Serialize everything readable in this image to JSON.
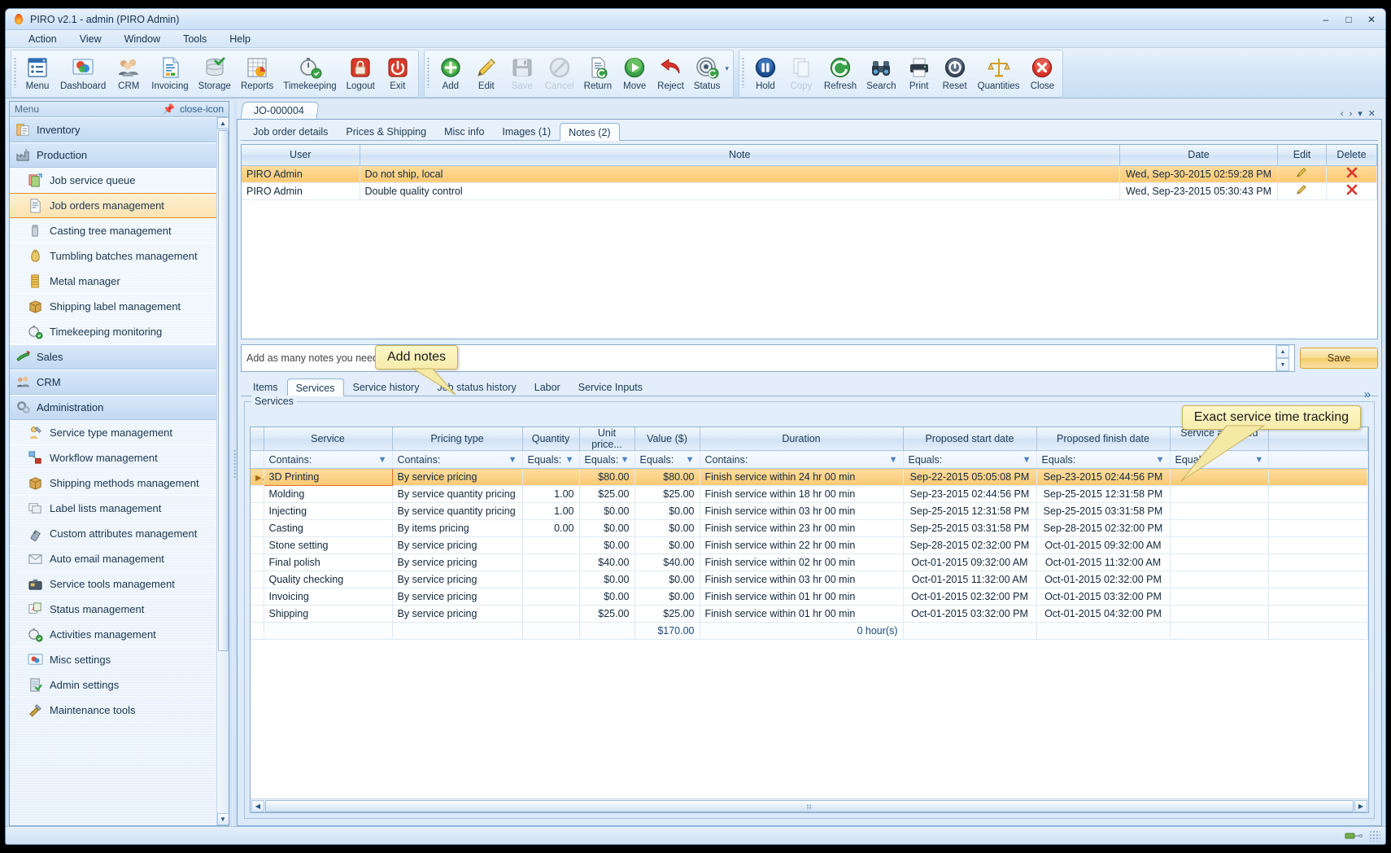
{
  "window": {
    "title": "PIRO v2.1  - admin (PIRO Admin)",
    "app_icon": "flame-icon",
    "minimize": "–",
    "maximize": "□",
    "close": "✕"
  },
  "menubar": [
    {
      "label": "Action"
    },
    {
      "label": "View"
    },
    {
      "label": "Window"
    },
    {
      "label": "Tools"
    },
    {
      "label": "Help"
    }
  ],
  "toolbar": {
    "group1": [
      {
        "label": "Menu",
        "icon": "menu-window-icon",
        "disabled": false
      },
      {
        "label": "Dashboard",
        "icon": "dashboard-icon",
        "disabled": false
      },
      {
        "label": "CRM",
        "icon": "people-icon",
        "disabled": false
      },
      {
        "label": "Invoicing",
        "icon": "document-invoice-icon",
        "disabled": false
      },
      {
        "label": "Storage",
        "icon": "database-icon",
        "disabled": false
      },
      {
        "label": "Reports",
        "icon": "report-chart-icon",
        "disabled": false
      },
      {
        "label": "Timekeeping",
        "icon": "stopwatch-icon",
        "disabled": false
      },
      {
        "label": "Logout",
        "icon": "lock-red-icon",
        "disabled": false
      },
      {
        "label": "Exit",
        "icon": "power-red-icon",
        "disabled": false
      }
    ],
    "group2": [
      {
        "label": "Add",
        "icon": "plus-green-icon",
        "disabled": false
      },
      {
        "label": "Edit",
        "icon": "pencil-icon",
        "disabled": false
      },
      {
        "label": "Save",
        "icon": "floppy-disk-icon",
        "disabled": true
      },
      {
        "label": "Cancel",
        "icon": "no-entry-icon",
        "disabled": true
      },
      {
        "label": "Return",
        "icon": "return-document-icon",
        "disabled": false
      },
      {
        "label": "Move",
        "icon": "play-green-icon",
        "disabled": false
      },
      {
        "label": "Reject",
        "icon": "red-arrow-icon",
        "disabled": false
      },
      {
        "label": "Status",
        "icon": "status-target-icon",
        "disabled": false,
        "has_dropdown": true
      }
    ],
    "group3": [
      {
        "label": "Hold",
        "icon": "pause-blue-icon",
        "disabled": false
      },
      {
        "label": "Copy",
        "icon": "copy-pages-icon",
        "disabled": true
      },
      {
        "label": "Refresh",
        "icon": "refresh-green-icon",
        "disabled": false
      },
      {
        "label": "Search",
        "icon": "binoculars-icon",
        "disabled": false
      },
      {
        "label": "Print",
        "icon": "printer-icon",
        "disabled": false
      },
      {
        "label": "Reset",
        "icon": "reset-power-icon",
        "disabled": false
      },
      {
        "label": "Quantities",
        "icon": "scales-icon",
        "disabled": false
      },
      {
        "label": "Close",
        "icon": "close-red-icon",
        "disabled": false
      }
    ]
  },
  "sidebar": {
    "caption": "Menu",
    "pin_icon": "pin-icon",
    "close_icon": "close-icon",
    "scroll_up": "▲",
    "scroll_down": "▼",
    "items": [
      {
        "label": "Inventory",
        "type": "group",
        "icon": "inventory-icon"
      },
      {
        "label": "Production",
        "type": "group",
        "icon": "factory-icon"
      },
      {
        "label": "Job service queue",
        "type": "item",
        "icon": "job-queue-icon"
      },
      {
        "label": "Job orders management",
        "type": "item",
        "icon": "job-orders-icon",
        "selected": true
      },
      {
        "label": "Casting tree management",
        "type": "item",
        "icon": "casting-tree-icon"
      },
      {
        "label": "Tumbling batches management",
        "type": "item",
        "icon": "tumbling-batch-icon"
      },
      {
        "label": "Metal manager",
        "type": "item",
        "icon": "metal-manager-icon"
      },
      {
        "label": "Shipping label management",
        "type": "item",
        "icon": "shipping-box-icon"
      },
      {
        "label": "Timekeeping monitoring",
        "type": "item",
        "icon": "stopwatch-icon"
      },
      {
        "label": "Sales",
        "type": "group",
        "icon": "sales-icon"
      },
      {
        "label": "CRM",
        "type": "group",
        "icon": "people-icon"
      },
      {
        "label": "Administration",
        "type": "group",
        "icon": "gears-icon"
      },
      {
        "label": "Service type management",
        "type": "item",
        "icon": "service-type-icon"
      },
      {
        "label": "Workflow management",
        "type": "item",
        "icon": "workflow-icon"
      },
      {
        "label": "Shipping methods management",
        "type": "item",
        "icon": "shipping-box-icon"
      },
      {
        "label": "Label lists management",
        "type": "item",
        "icon": "label-lists-icon"
      },
      {
        "label": "Custom attributes management",
        "type": "item",
        "icon": "custom-attributes-icon"
      },
      {
        "label": "Auto email management",
        "type": "item",
        "icon": "email-icon"
      },
      {
        "label": "Service tools management",
        "type": "item",
        "icon": "toolbox-icon"
      },
      {
        "label": "Status management",
        "type": "item",
        "icon": "status-cards-icon"
      },
      {
        "label": "Activities management",
        "type": "item",
        "icon": "stopwatch-icon"
      },
      {
        "label": "Misc settings",
        "type": "item",
        "icon": "misc-settings-icon"
      },
      {
        "label": "Admin settings",
        "type": "item",
        "icon": "admin-settings-icon"
      },
      {
        "label": "Maintenance tools",
        "type": "item",
        "icon": "maintenance-tools-icon"
      }
    ]
  },
  "document": {
    "tab_label": "JO-000004",
    "nav_prev": "‹",
    "nav_next": "›",
    "nav_list": "▾",
    "nav_close": "✕"
  },
  "top_tabs": [
    {
      "label": "Job order details",
      "active": false
    },
    {
      "label": "Prices & Shipping",
      "active": false
    },
    {
      "label": "Misc info",
      "active": false
    },
    {
      "label": "Images (1)",
      "active": false
    },
    {
      "label": "Notes (2)",
      "active": true
    }
  ],
  "notes": {
    "columns": [
      "User",
      "Note",
      "Date",
      "Edit",
      "Delete"
    ],
    "rows": [
      {
        "user": "PIRO Admin",
        "note": "Do not ship, local",
        "date": "Wed, Sep-30-2015 02:59:28 PM",
        "edit_icon": "pencil-icon",
        "delete_icon": "red-x-icon",
        "selected": true
      },
      {
        "user": "PIRO Admin",
        "note": "Double quality control",
        "date": "Wed, Sep-23-2015 05:30:43 PM",
        "edit_icon": "pencil-icon",
        "delete_icon": "red-x-icon",
        "selected": false
      }
    ],
    "callout": "Add notes",
    "input_placeholder": "Add as many notes you need!",
    "input_value": "",
    "spin_up": "▲",
    "spin_down": "▼",
    "save_label": "Save"
  },
  "bottom_tabs": [
    {
      "label": "Items",
      "active": false
    },
    {
      "label": "Services",
      "active": true
    },
    {
      "label": "Service history",
      "active": false
    },
    {
      "label": "Job status history",
      "active": false
    },
    {
      "label": "Labor",
      "active": false
    },
    {
      "label": "Service Inputs",
      "active": false
    }
  ],
  "services": {
    "group_title": "Services",
    "expand_icon": "chevron-double-down-icon",
    "callout": "Exact service time tracking",
    "columns": [
      "Service",
      "Pricing type",
      "Quantity",
      "Unit price...",
      "Value ($)",
      "Duration",
      "Proposed start date",
      "Proposed finish date",
      "Service assigned to"
    ],
    "filters": [
      "Contains:",
      "Contains:",
      "Equals:",
      "Equals:",
      "Equals:",
      "Contains:",
      "Equals:",
      "Equals:",
      "Equals:"
    ],
    "rows": [
      {
        "service": "3D Printing",
        "pricing_type": "By service pricing",
        "quantity": "",
        "unit_price": "$80.00",
        "value": "$80.00",
        "duration": "Finish service within 24 hr 00 min",
        "start": "Sep-22-2015 05:05:08 PM",
        "finish": "Sep-23-2015 02:44:56 PM",
        "assigned": "",
        "selected": true
      },
      {
        "service": "Molding",
        "pricing_type": "By service quantity pricing",
        "quantity": "1.00",
        "unit_price": "$25.00",
        "value": "$25.00",
        "duration": "Finish service within 18 hr 00 min",
        "start": "Sep-23-2015 02:44:56 PM",
        "finish": "Sep-25-2015 12:31:58 PM",
        "assigned": "",
        "selected": false
      },
      {
        "service": "Injecting",
        "pricing_type": "By service quantity pricing",
        "quantity": "1.00",
        "unit_price": "$0.00",
        "value": "$0.00",
        "duration": "Finish service within 03 hr 00 min",
        "start": "Sep-25-2015 12:31:58 PM",
        "finish": "Sep-25-2015 03:31:58 PM",
        "assigned": "",
        "selected": false
      },
      {
        "service": "Casting",
        "pricing_type": "By items pricing",
        "quantity": "0.00",
        "unit_price": "$0.00",
        "value": "$0.00",
        "duration": "Finish service within 23 hr 00 min",
        "start": "Sep-25-2015 03:31:58 PM",
        "finish": "Sep-28-2015 02:32:00 PM",
        "assigned": "",
        "selected": false
      },
      {
        "service": "Stone setting",
        "pricing_type": "By service pricing",
        "quantity": "",
        "unit_price": "$0.00",
        "value": "$0.00",
        "duration": "Finish service within 22 hr 00 min",
        "start": "Sep-28-2015 02:32:00 PM",
        "finish": "Oct-01-2015 09:32:00 AM",
        "assigned": "",
        "selected": false
      },
      {
        "service": "Final polish",
        "pricing_type": "By service pricing",
        "quantity": "",
        "unit_price": "$40.00",
        "value": "$40.00",
        "duration": "Finish service within 02 hr 00 min",
        "start": "Oct-01-2015 09:32:00 AM",
        "finish": "Oct-01-2015 11:32:00 AM",
        "assigned": "",
        "selected": false
      },
      {
        "service": "Quality checking",
        "pricing_type": "By service pricing",
        "quantity": "",
        "unit_price": "$0.00",
        "value": "$0.00",
        "duration": "Finish service within 03 hr 00 min",
        "start": "Oct-01-2015 11:32:00 AM",
        "finish": "Oct-01-2015 02:32:00 PM",
        "assigned": "",
        "selected": false
      },
      {
        "service": "Invoicing",
        "pricing_type": "By service pricing",
        "quantity": "",
        "unit_price": "$0.00",
        "value": "$0.00",
        "duration": "Finish service within 01 hr 00 min",
        "start": "Oct-01-2015 02:32:00 PM",
        "finish": "Oct-01-2015 03:32:00 PM",
        "assigned": "",
        "selected": false
      },
      {
        "service": "Shipping",
        "pricing_type": "By service pricing",
        "quantity": "",
        "unit_price": "$25.00",
        "value": "$25.00",
        "duration": "Finish service within 01 hr 00 min",
        "start": "Oct-01-2015 03:32:00 PM",
        "finish": "Oct-01-2015 04:32:00 PM",
        "assigned": "",
        "selected": false
      }
    ],
    "summary": {
      "value_total": "$170.00",
      "duration_total": "0 hour(s)"
    }
  },
  "statusbar": {
    "indicator_icon": "connection-icon",
    "grip_icon": "resize-grip-icon"
  }
}
